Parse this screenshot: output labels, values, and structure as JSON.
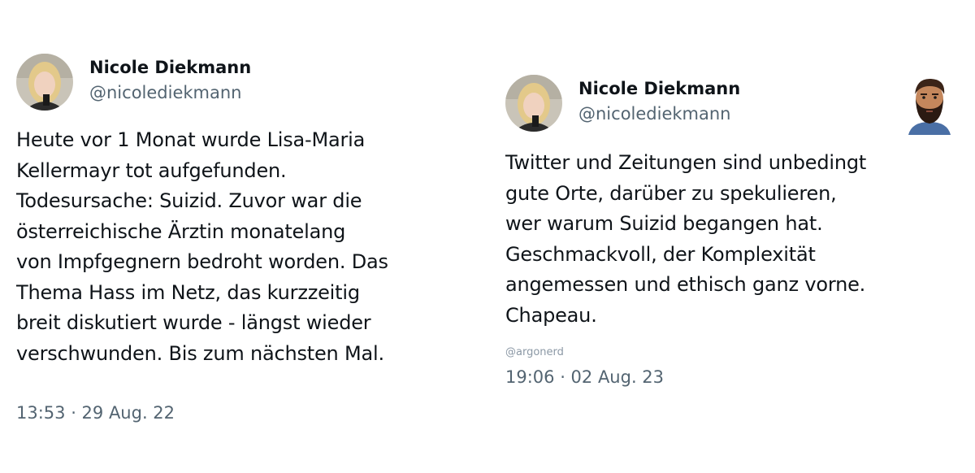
{
  "tweets": [
    {
      "name": "Nicole Diekmann",
      "handle": "@nicolediekmann",
      "text": "Heute vor 1 Monat wurde Lisa-Maria\nKellermayr tot aufgefunden.\nTodesursache: Suizid. Zuvor war die\nösterreichische Ärztin monatelang\nvon Impfgegnern bedroht worden. Das\nThema Hass im Netz, das kurzzeitig\nbreit diskutiert wurde - längst wieder\nverschwunden. Bis zum nächsten Mal.",
      "timestamp": "13:53 · 29 Aug. 22"
    },
    {
      "name": "Nicole Diekmann",
      "handle": "@nicolediekmann",
      "text": "Twitter und Zeitungen sind unbedingt\ngute Orte, darüber zu spekulieren,\nwer warum Suizid begangen hat.\nGeschmackvoll, der Komplexität\nangemessen und ethisch ganz vorne.\nChapeau.",
      "watermark": "@argonerd",
      "timestamp": "19:06 · 02 Aug. 23"
    }
  ],
  "icons": {
    "profile_avatar": "profile-photo",
    "corner_avatar": "bearded-man-illustration"
  }
}
